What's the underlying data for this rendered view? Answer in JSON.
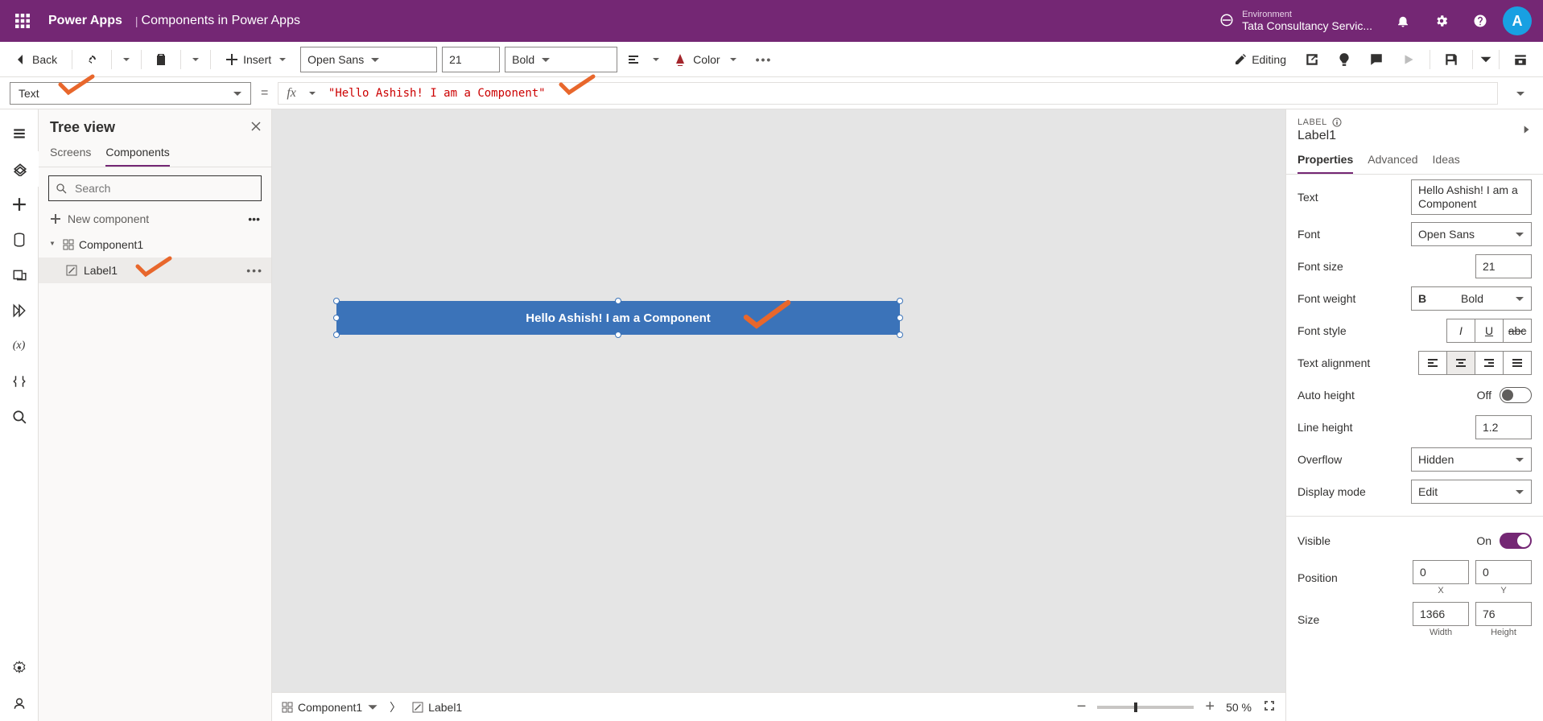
{
  "topbar": {
    "brand": "Power Apps",
    "title": "Components in Power Apps",
    "env_label": "Environment",
    "env_name": "Tata Consultancy Servic...",
    "avatar_initial": "A"
  },
  "cmdbar": {
    "back": "Back",
    "insert": "Insert",
    "font": "Open Sans",
    "font_size": "21",
    "font_weight": "Bold",
    "color": "Color",
    "editing": "Editing"
  },
  "formula": {
    "property": "Text",
    "expression": "\"Hello Ashish! I am a Component\""
  },
  "tree": {
    "title": "Tree view",
    "tab_screens": "Screens",
    "tab_components": "Components",
    "search_ph": "Search",
    "new_component": "New component",
    "items": {
      "component": "Component1",
      "label": "Label1"
    }
  },
  "canvas": {
    "label_text": "Hello Ashish! I am a Component"
  },
  "status": {
    "crumb1": "Component1",
    "crumb2": "Label1",
    "zoom": "50 %"
  },
  "props": {
    "type_label": "LABEL",
    "control_name": "Label1",
    "tabs": {
      "properties": "Properties",
      "advanced": "Advanced",
      "ideas": "Ideas"
    },
    "rows": {
      "text_label": "Text",
      "text_value": "Hello Ashish! I am a Component",
      "font_label": "Font",
      "font_value": "Open Sans",
      "fontsize_label": "Font size",
      "fontsize_value": "21",
      "fontweight_label": "Font weight",
      "fontweight_value": "Bold",
      "fontstyle_label": "Font style",
      "align_label": "Text alignment",
      "autoheight_label": "Auto height",
      "autoheight_value": "Off",
      "lineheight_label": "Line height",
      "lineheight_value": "1.2",
      "overflow_label": "Overflow",
      "overflow_value": "Hidden",
      "displaymode_label": "Display mode",
      "displaymode_value": "Edit",
      "visible_label": "Visible",
      "visible_value": "On",
      "position_label": "Position",
      "pos_x": "0",
      "pos_y": "0",
      "pos_x_lbl": "X",
      "pos_y_lbl": "Y",
      "size_label": "Size",
      "size_w": "1366",
      "size_h": "76",
      "size_w_lbl": "Width",
      "size_h_lbl": "Height"
    }
  }
}
